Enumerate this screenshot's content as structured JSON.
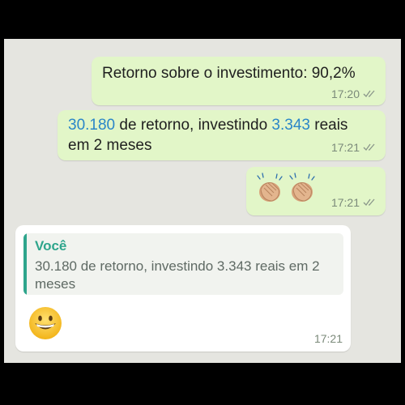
{
  "messages": {
    "m1": {
      "text": "Retorno sobre o investimento: 90,2%",
      "time": "17:20"
    },
    "m2": {
      "number1": "30.180",
      "text1": " de retorno, investindo ",
      "number2": "3.343",
      "text2": " reais",
      "line2": "em 2 meses",
      "time": "17:21"
    },
    "m3": {
      "emoji": "clapping-hands",
      "time": "17:21"
    },
    "m4": {
      "quote_author": "Você",
      "quote_text": "30.180 de retorno, investindo 3.343 reais em 2 meses",
      "emoji": "grinning-face",
      "time": "17:21"
    }
  },
  "colors": {
    "outgoing_bubble": "#e2f6c8",
    "incoming_bubble": "#ffffff",
    "chat_background": "#e5e5e0",
    "number_link": "#2a86c8",
    "quote_accent": "#2ea58c"
  }
}
